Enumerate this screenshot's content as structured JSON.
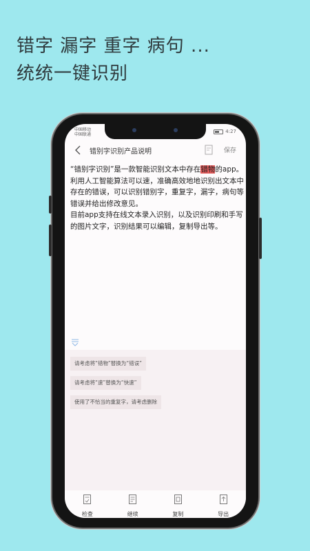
{
  "promo": {
    "line1": "错字 漏字 重字 病句 ...",
    "line2": "统统一键识别"
  },
  "statusbar": {
    "carrier1": "中国移动",
    "carrier2": "中国联通",
    "time": "4:27"
  },
  "nav": {
    "title": "错别字识别产品说明",
    "save_label": "保存"
  },
  "document": {
    "p1_before": "“错别字识别”是一款智能识别文本中存在",
    "p1_highlight": "错物",
    "p1_after": "的app。利用人工智能算法可以速，准确高效地地识别出文本中存在的错误，可以识别错别字，重复字，漏字，病句等错误并给出修改意见。",
    "p2": "目前app支持在线文本录入识别，以及识别印刷和手写的图片文字，识别结果可以编辑，复制导出等。",
    "highlight_color": "#e35b5b"
  },
  "suggestions": [
    "请考虑将“错物”替换为“错误”",
    "请考虑将“速”替换为“快速”",
    "使用了不恰当的重复字，请考虑删除"
  ],
  "toolbar": {
    "check": "检查",
    "continue": "继续",
    "copy": "复制",
    "export": "导出"
  }
}
